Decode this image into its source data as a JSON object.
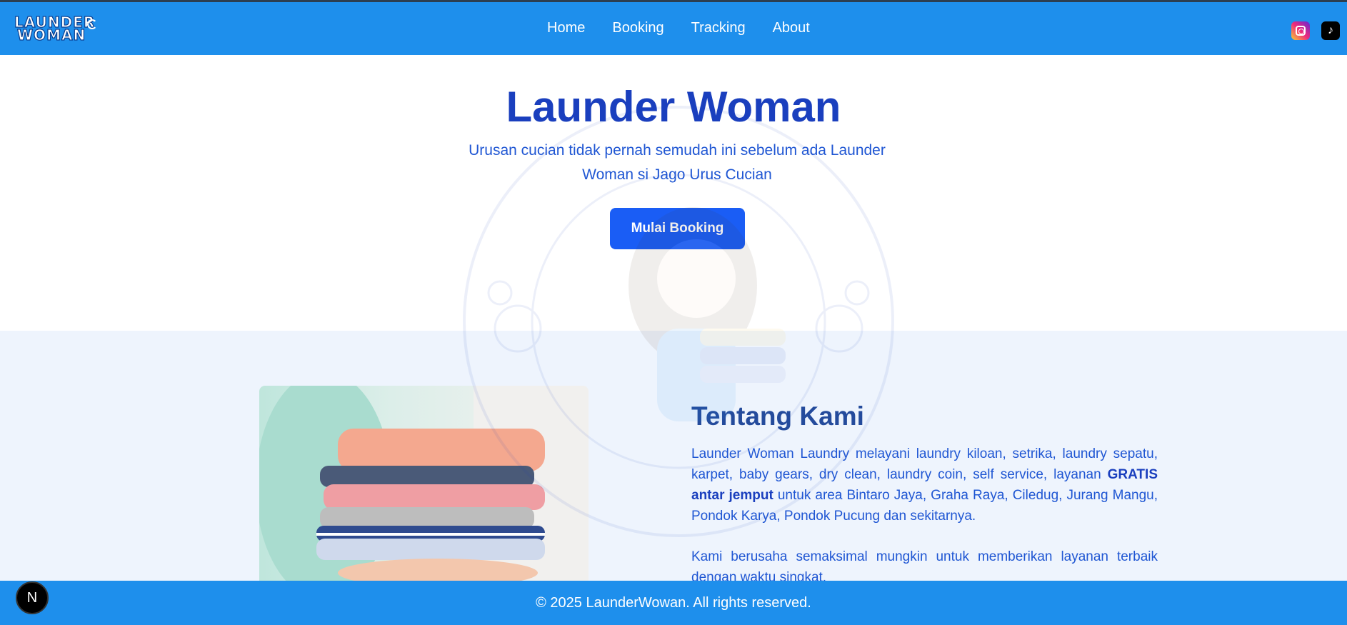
{
  "brand": {
    "logo_line1": "LAUNDER",
    "logo_line2": "WOMAN"
  },
  "nav": {
    "items": [
      {
        "label": "Home"
      },
      {
        "label": "Booking"
      },
      {
        "label": "Tracking"
      },
      {
        "label": "About"
      }
    ],
    "social": [
      {
        "name": "instagram-icon"
      },
      {
        "name": "tiktok-icon",
        "glyph": "♪"
      }
    ]
  },
  "hero": {
    "title": "Launder Woman",
    "subtitle": "Urusan cucian tidak pernah semudah ini sebelum ada Launder Woman si Jago Urus Cucian",
    "cta_label": "Mulai Booking"
  },
  "about": {
    "title": "Tentang Kami",
    "paragraph1_pre": "Launder Woman Laundry melayani laundry kiloan, setrika, laundry sepatu, karpet, baby gears, dry clean, laundry coin, self service, layanan ",
    "paragraph1_bold": "GRATIS antar jemput",
    "paragraph1_post": " untuk area Bintaro Jaya, Graha Raya, Ciledug, Jurang Mangu, Pondok Karya, Pondok Pucung dan sekitarnya.",
    "paragraph2": "Kami berusaha semaksimal mungkin untuk memberikan layanan terbaik dengan waktu singkat."
  },
  "footer": {
    "text": "© 2025 LaunderWowan. All rights reserved."
  },
  "dev_badge": {
    "glyph": "N"
  },
  "colors": {
    "navbar": "#1e8fec",
    "title": "#1a3fbe",
    "cta": "#1a5df5",
    "about_bg": "#eef4fd"
  }
}
